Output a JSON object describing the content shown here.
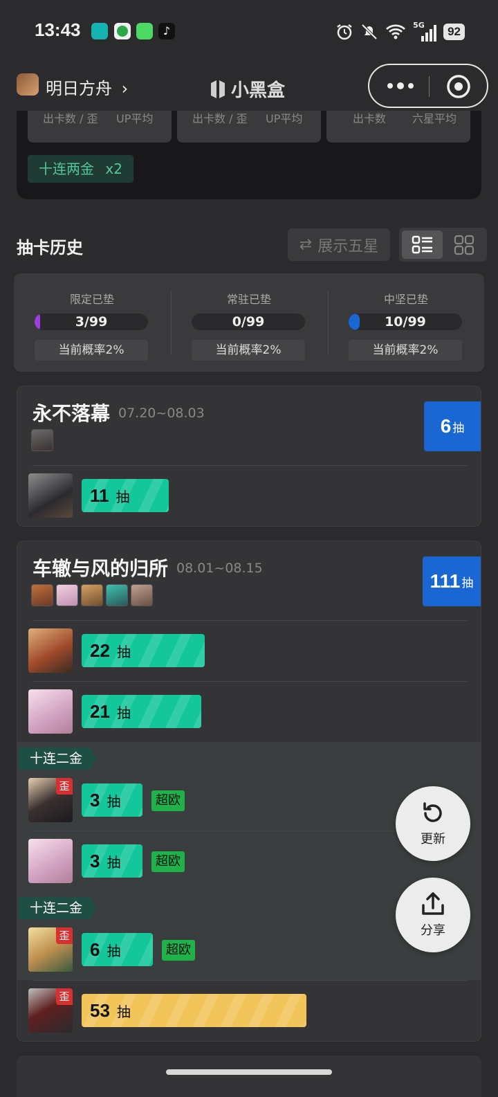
{
  "status_bar": {
    "time": "13:43",
    "network": "5G",
    "battery": "92"
  },
  "nav": {
    "game_name": "明日方舟",
    "app_title": "小黑盒"
  },
  "top_card": {
    "stats": [
      {
        "left": "出卡数 / 歪",
        "right": "UP平均"
      },
      {
        "left": "出卡数 / 歪",
        "right": "UP平均"
      },
      {
        "left": "出卡数",
        "right": "六星平均"
      }
    ],
    "tenpull_tag": "十连两金",
    "tenpull_count": "x2"
  },
  "history": {
    "title": "抽卡历史",
    "show_five_star": "展示五星"
  },
  "pity": [
    {
      "label": "限定已垫",
      "value": "3/99",
      "progress": 0.03,
      "color": "#9b3fe0",
      "rate": "当前概率2%"
    },
    {
      "label": "常驻已垫",
      "value": "0/99",
      "progress": 0,
      "color": "#1a66d2",
      "rate": "当前概率2%"
    },
    {
      "label": "中坚已垫",
      "value": "10/99",
      "progress": 0.1,
      "color": "#1a66d2",
      "rate": "当前概率2%"
    }
  ],
  "banners": [
    {
      "name": "永不落幕",
      "date": "07.20~08.03",
      "count": "6",
      "count_unit": "抽",
      "pulls": [
        {
          "value": "11",
          "unit": "抽"
        }
      ]
    },
    {
      "name": "车辙与风的归所",
      "date": "08.01~08.15",
      "count": "111",
      "count_unit": "抽",
      "pulls": [
        {
          "value": "22",
          "unit": "抽"
        },
        {
          "value": "21",
          "unit": "抽"
        },
        {
          "value": "3",
          "unit": "抽",
          "tag": "超欧",
          "wai": "歪"
        },
        {
          "value": "3",
          "unit": "抽",
          "tag": "超欧"
        },
        {
          "value": "6",
          "unit": "抽",
          "tag": "超欧",
          "wai": "歪"
        },
        {
          "value": "53",
          "unit": "抽",
          "wai": "歪"
        }
      ],
      "multi_label": "十连二金"
    }
  ],
  "fab": {
    "refresh": "更新",
    "share": "分享"
  }
}
